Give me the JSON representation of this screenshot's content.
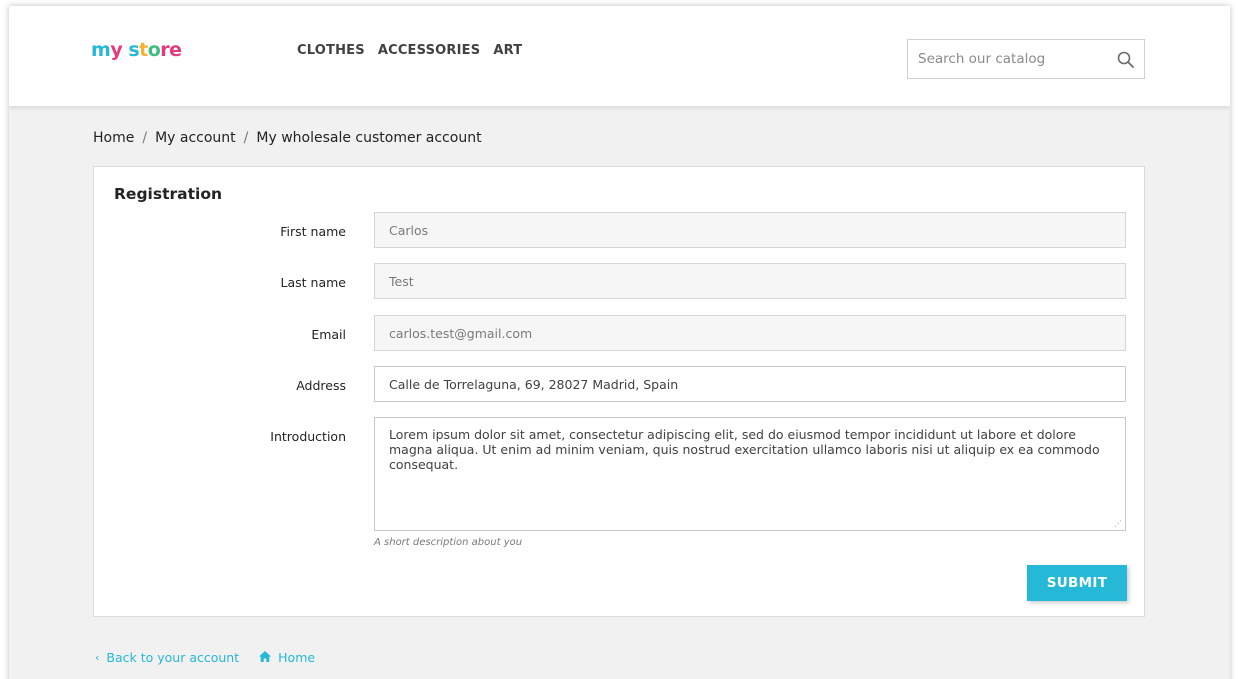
{
  "header": {
    "logo": [
      "m",
      "y",
      " s",
      "t",
      "o",
      "re"
    ],
    "nav": [
      "CLOTHES",
      "ACCESSORIES",
      "ART"
    ],
    "search": {
      "placeholder": "Search our catalog",
      "icon": "search-icon"
    }
  },
  "breadcrumb": {
    "items": [
      "Home",
      "My account",
      "My wholesale customer account"
    ],
    "separator": "/"
  },
  "form": {
    "title": "Registration",
    "fields": {
      "first_name": {
        "label": "First name",
        "value": "Carlos"
      },
      "last_name": {
        "label": "Last name",
        "value": "Test"
      },
      "email": {
        "label": "Email",
        "value": "carlos.test@gmail.com"
      },
      "address": {
        "label": "Address",
        "value": "Calle de Torrelaguna, 69, 28027 Madrid, Spain"
      },
      "introduction": {
        "label": "Introduction",
        "value": "Lorem ipsum dolor sit amet, consectetur adipiscing elit, sed do eiusmod tempor incididunt ut labore et dolore magna aliqua. Ut enim ad minim veniam, quis nostrud exercitation ullamco laboris nisi ut aliquip ex ea commodo consequat.",
        "hint": "A short description about you"
      }
    },
    "submit_label": "SUBMIT"
  },
  "footer": {
    "back_label": "Back to your account",
    "home_label": "Home",
    "back_icon": "chevron-left-icon",
    "home_icon": "home-icon"
  },
  "colors": {
    "accent": "#25b9d7",
    "background": "#f1f1f1"
  }
}
